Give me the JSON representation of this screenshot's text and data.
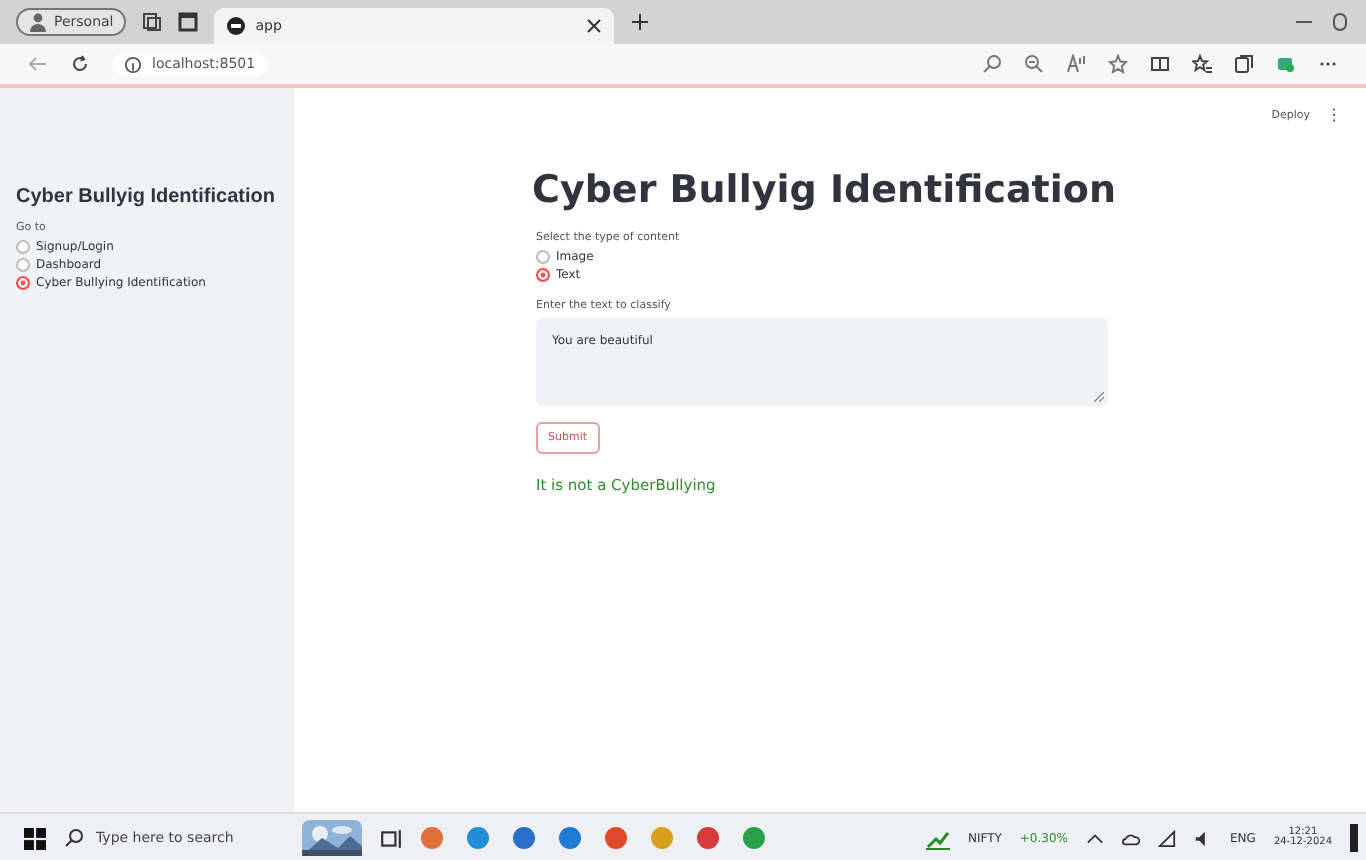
{
  "browser": {
    "profile": "Personal",
    "tab_title": "app",
    "address": "localhost:8501"
  },
  "app_header": {
    "deploy": "Deploy",
    "menu": "⋮"
  },
  "sidebar": {
    "title": "Cyber Bullyig Identification",
    "nav_label": "Go to",
    "items": [
      {
        "label": "Signup/Login",
        "selected": false
      },
      {
        "label": "Dashboard",
        "selected": false
      },
      {
        "label": "Cyber Bullying Identification",
        "selected": true
      }
    ]
  },
  "main": {
    "title": "Cyber Bullyig Identification",
    "content_type_label": "Select the type of content",
    "content_types": [
      {
        "label": "Image",
        "selected": false
      },
      {
        "label": "Text",
        "selected": true
      }
    ],
    "text_label": "Enter the text to classify",
    "text_value": "You are beautiful",
    "submit": "Submit",
    "result": "It is not a CyberBullying"
  },
  "taskbar": {
    "search_placeholder": "Type here to search",
    "stock_name": "NIFTY",
    "stock_change": "+0.30%",
    "language": "ENG",
    "time": "12:21",
    "date": "24-12-2024"
  }
}
